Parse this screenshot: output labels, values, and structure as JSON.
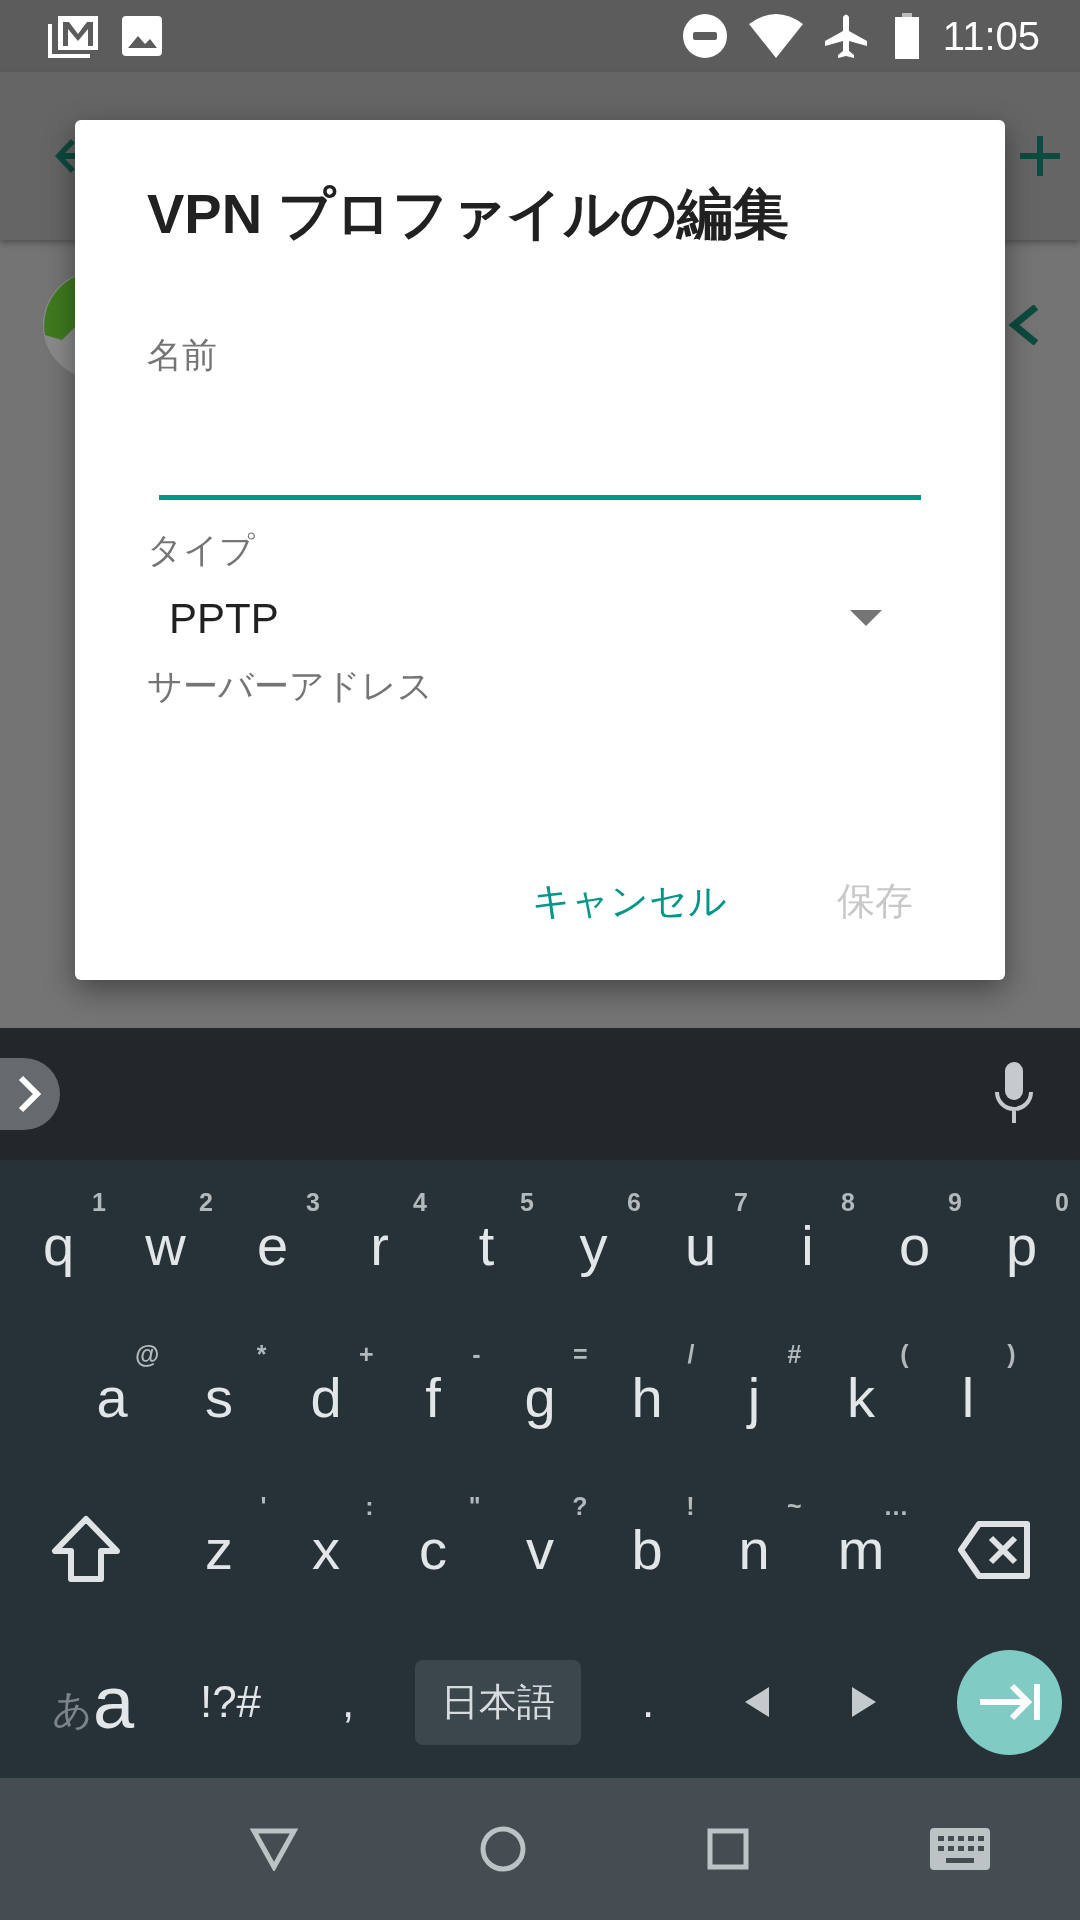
{
  "status_bar": {
    "time": "11:05"
  },
  "dialog": {
    "title": "VPN プロファイルの編集",
    "fields": [
      {
        "kind": "text",
        "label": "名前",
        "focused": true
      },
      {
        "kind": "select",
        "label": "タイプ",
        "value": "PPTP"
      },
      {
        "kind": "label",
        "label": "サーバーアドレス"
      }
    ],
    "buttons": [
      {
        "label": "キャンセル",
        "disabled": false
      },
      {
        "label": "保存",
        "disabled": true
      }
    ]
  },
  "keyboard": {
    "rows": [
      {
        "keys": [
          {
            "kind": "letter",
            "label": "q",
            "hint": "1"
          },
          {
            "kind": "letter",
            "label": "w",
            "hint": "2"
          },
          {
            "kind": "letter",
            "label": "e",
            "hint": "3"
          },
          {
            "kind": "letter",
            "label": "r",
            "hint": "4"
          },
          {
            "kind": "letter",
            "label": "t",
            "hint": "5"
          },
          {
            "kind": "letter",
            "label": "y",
            "hint": "6"
          },
          {
            "kind": "letter",
            "label": "u",
            "hint": "7"
          },
          {
            "kind": "letter",
            "label": "i",
            "hint": "8"
          },
          {
            "kind": "letter",
            "label": "o",
            "hint": "9"
          },
          {
            "kind": "letter",
            "label": "p",
            "hint": "0"
          }
        ]
      },
      {
        "keys": [
          {
            "kind": "letter",
            "label": "a",
            "hint": "@"
          },
          {
            "kind": "letter",
            "label": "s",
            "hint": "*"
          },
          {
            "kind": "letter",
            "label": "d",
            "hint": "+"
          },
          {
            "kind": "letter",
            "label": "f",
            "hint": "-"
          },
          {
            "kind": "letter",
            "label": "g",
            "hint": "="
          },
          {
            "kind": "letter",
            "label": "h",
            "hint": "/"
          },
          {
            "kind": "letter",
            "label": "j",
            "hint": "#"
          },
          {
            "kind": "letter",
            "label": "k",
            "hint": "("
          },
          {
            "kind": "letter",
            "label": "l",
            "hint": ")"
          }
        ]
      },
      {
        "keys": [
          {
            "kind": "shift"
          },
          {
            "kind": "letter",
            "label": "z",
            "hint": "'"
          },
          {
            "kind": "letter",
            "label": "x",
            "hint": ":"
          },
          {
            "kind": "letter",
            "label": "c",
            "hint": "\""
          },
          {
            "kind": "letter",
            "label": "v",
            "hint": "?"
          },
          {
            "kind": "letter",
            "label": "b",
            "hint": "!"
          },
          {
            "kind": "letter",
            "label": "n",
            "hint": "~"
          },
          {
            "kind": "letter",
            "label": "m",
            "hint": "…"
          },
          {
            "kind": "delete"
          }
        ]
      },
      {
        "keys": [
          {
            "kind": "mode",
            "small": "あ",
            "label": "a"
          },
          {
            "kind": "symbol",
            "label": "!?#"
          },
          {
            "kind": "symbol",
            "label": ","
          },
          {
            "kind": "language",
            "label": "日本語"
          },
          {
            "kind": "symbol",
            "label": "."
          },
          {
            "kind": "left"
          },
          {
            "kind": "right"
          },
          {
            "kind": "enter"
          }
        ]
      }
    ]
  }
}
